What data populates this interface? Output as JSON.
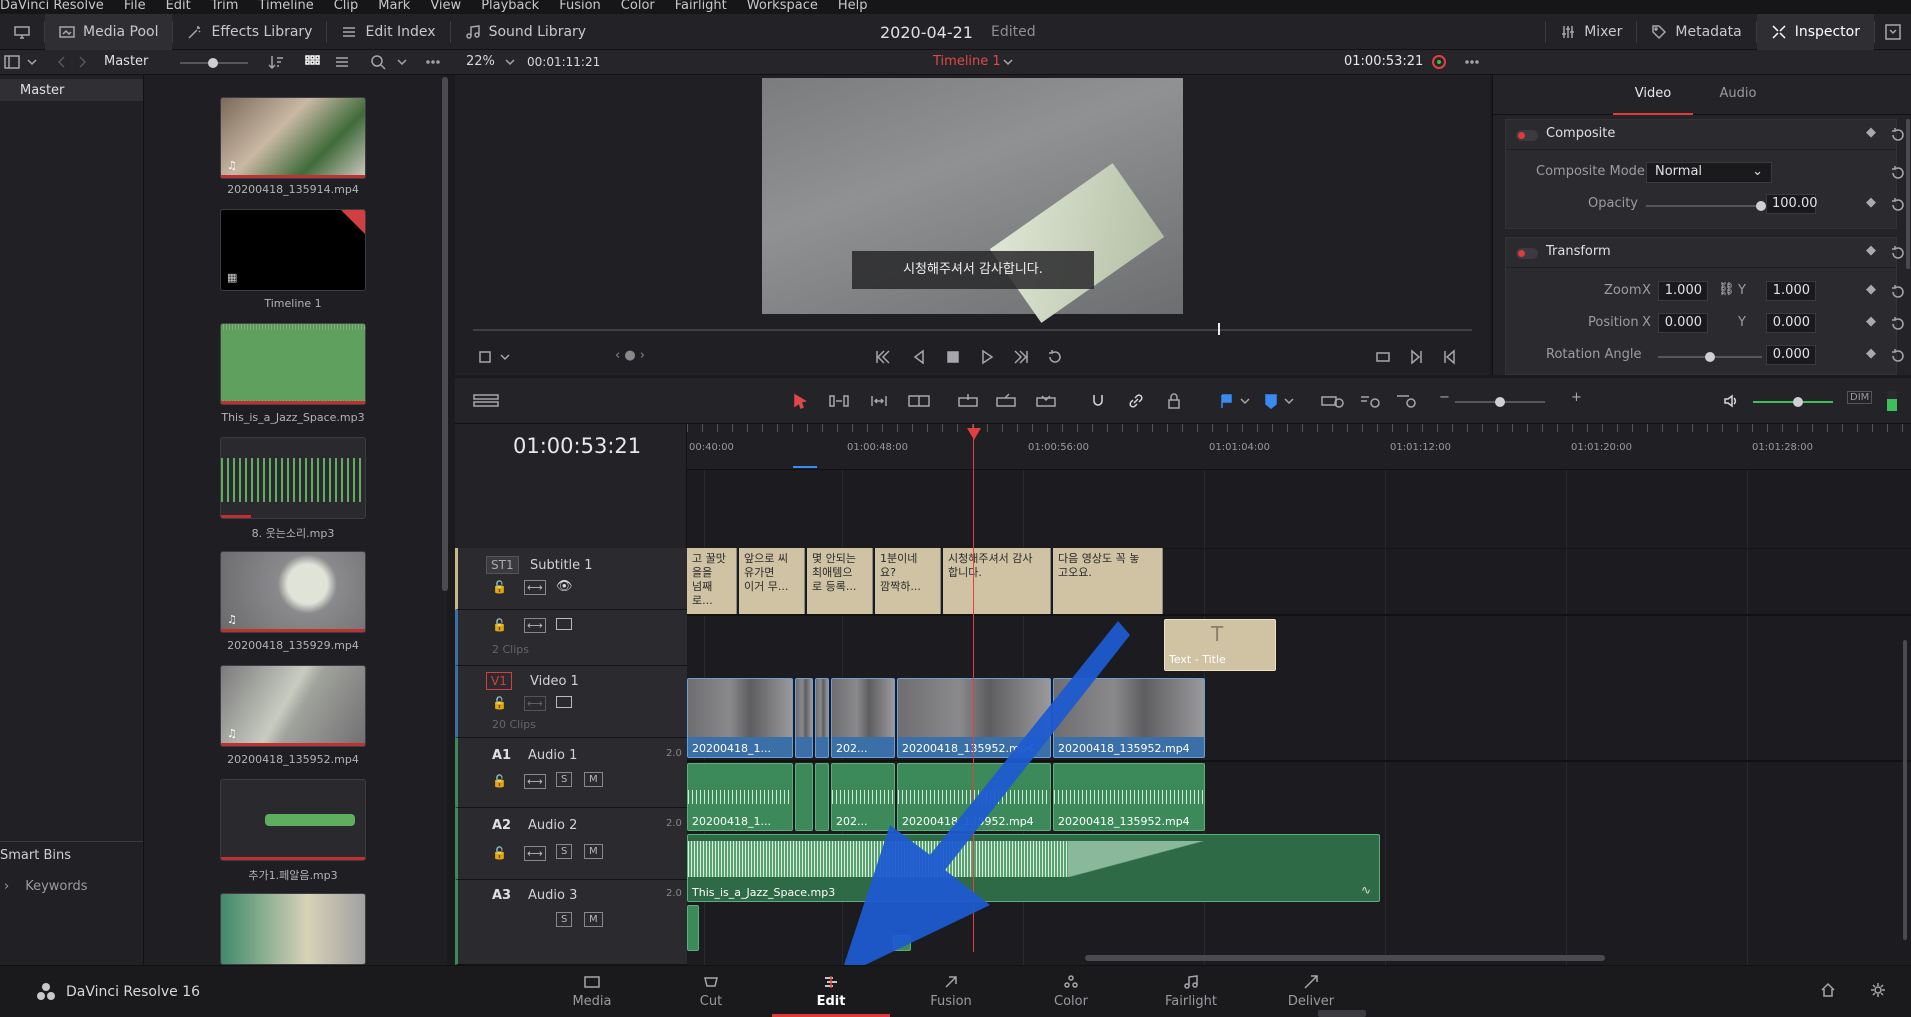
{
  "menu": [
    "DaVinci Resolve",
    "File",
    "Edit",
    "Trim",
    "Timeline",
    "Clip",
    "Mark",
    "View",
    "Playback",
    "Fusion",
    "Color",
    "Fairlight",
    "Workspace",
    "Help"
  ],
  "toolbar": {
    "media_pool": "Media Pool",
    "effects_library": "Effects Library",
    "edit_index": "Edit Index",
    "sound_library": "Sound Library",
    "mixer": "Mixer",
    "metadata": "Metadata",
    "inspector": "Inspector"
  },
  "project": {
    "title": "2020-04-21",
    "status": "Edited"
  },
  "subbar": {
    "bin": "Master",
    "zoom": "22%",
    "duration": "00:01:11:21",
    "timeline_name": "Timeline 1",
    "timecode": "01:00:53:21"
  },
  "bins": {
    "master": "Master",
    "smart_bins": "Smart Bins",
    "keywords": "Keywords"
  },
  "clips": [
    "20200418_135914.mp4",
    "Timeline 1",
    "This_is_a_Jazz_Space.mp3",
    "8. 웃는소리.mp3",
    "20200418_135929.mp4",
    "20200418_135952.mp4",
    "추가1.페알음.mp3"
  ],
  "viewer": {
    "subtitle": "시청해주셔서 감사합니다."
  },
  "inspector": {
    "tabs": [
      "Video",
      "Audio"
    ],
    "composite": {
      "title": "Composite",
      "mode_label": "Composite Mode",
      "mode": "Normal",
      "opacity_label": "Opacity",
      "opacity": "100.00"
    },
    "transform": {
      "title": "Transform",
      "zoom_label": "Zoom",
      "zoom_x": "1.000",
      "zoom_y": "1.000",
      "position_label": "Position",
      "pos_x": "0.000",
      "pos_y": "0.000",
      "rotation_label": "Rotation Angle",
      "rotation": "0.000",
      "x": "X",
      "y": "Y"
    }
  },
  "timeline": {
    "timecode": "01:00:53:21",
    "ruler": [
      "00:40:00",
      "01:00:48:00",
      "01:00:56:00",
      "01:01:04:00",
      "01:01:12:00",
      "01:01:20:00",
      "01:01:28:00"
    ],
    "tracks": {
      "st1": {
        "tag": "ST1",
        "name": "Subtitle 1"
      },
      "v2": {
        "clips": "2 Clips"
      },
      "v1": {
        "tag": "V1",
        "name": "Video 1",
        "clips": "20 Clips"
      },
      "a1": {
        "tag": "A1",
        "name": "Audio 1",
        "ch": "2.0"
      },
      "a2": {
        "tag": "A2",
        "name": "Audio 2",
        "ch": "2.0"
      },
      "a3": {
        "tag": "A3",
        "name": "Audio 3",
        "ch": "2.0"
      }
    },
    "subtitles": [
      "고 꿀맛\n을을\n넘째로...",
      "앞으로 씨\n유가면\n이거 무...",
      "몇 안되는\n최애템으\n로 등록...",
      "1분이네\n요?\n깜짝하...",
      "시청해주셔서 감사\n합니다.",
      "다음 영상도 꼭 놓\n고오요."
    ],
    "title_clip": "Text - Title",
    "video_clips": [
      "20200418_1...",
      "202...",
      "20200418_135952.mp4",
      "20200418_135952.mp4"
    ],
    "audio1_clips": [
      "20200418_1...",
      "202...",
      "20200418_135952.mp4",
      "20200418_135952.mp4"
    ],
    "audio2_clip": "This_is_a_Jazz_Space.mp3",
    "dim": "DIM"
  },
  "pages": [
    "Media",
    "Cut",
    "Edit",
    "Fusion",
    "Color",
    "Fairlight",
    "Deliver"
  ],
  "app_name": "DaVinci Resolve 16"
}
